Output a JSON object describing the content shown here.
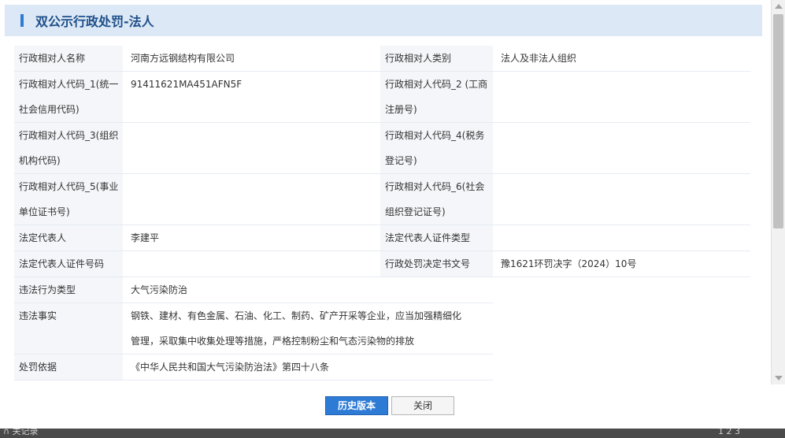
{
  "header": {
    "title": "双公示行政处罚-法人"
  },
  "rows": [
    {
      "l1": "行政相对人名称",
      "v1": "河南方远钢结构有限公司",
      "l2": "行政相对人类别",
      "v2": "法人及非法人组织"
    },
    {
      "l1": "行政相对人代码_1(统一社会信用代码)",
      "v1": "91411621MA451AFN5F",
      "l2": "行政相对人代码_2 (工商注册号)",
      "v2": ""
    },
    {
      "l1": "行政相对人代码_3(组织机构代码)",
      "v1": "",
      "l2": "行政相对人代码_4(税务登记号)",
      "v2": ""
    },
    {
      "l1": "行政相对人代码_5(事业单位证书号)",
      "v1": "",
      "l2": "行政相对人代码_6(社会组织登记证号)",
      "v2": ""
    },
    {
      "l1": "法定代表人",
      "v1": "李建平",
      "l2": "法定代表人证件类型",
      "v2": ""
    },
    {
      "l1": "法定代表人证件号码",
      "v1": "",
      "l2": "行政处罚决定书文号",
      "v2": "豫1621环罚决字（2024）10号"
    }
  ],
  "full_rows": [
    {
      "label": "违法行为类型",
      "value": "大气污染防治"
    },
    {
      "label": "违法事实",
      "value": "钢铁、建材、有色金属、石油、化工、制药、矿产开采等企业，应当加强精细化管理，采取集中收集处理等措施，严格控制粉尘和气态污染物的排放"
    },
    {
      "label": "处罚依据",
      "value": "《中华人民共和国大气污染防治法》第四十八条"
    }
  ],
  "buttons": {
    "history": "历史版本",
    "close": "关闭"
  },
  "bottom_strip": {
    "left_text": "∩ 关记录",
    "right_text": "1  2  3"
  },
  "colors": {
    "accent": "#2e7bd6",
    "header_bg": "#dce8f5",
    "label_bg": "#f4f6f9"
  }
}
